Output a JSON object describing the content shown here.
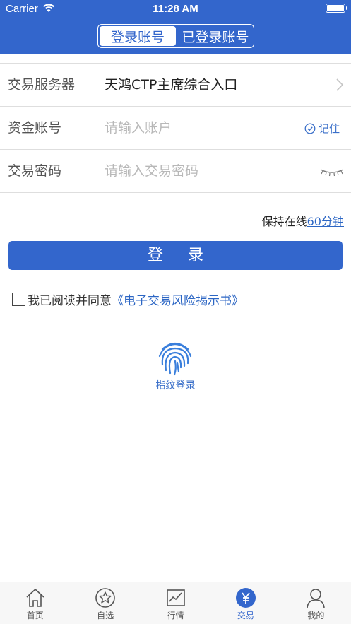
{
  "status": {
    "carrier": "Carrier",
    "time": "11:28 AM"
  },
  "segment": {
    "tabs": [
      {
        "label": "登录账号",
        "active": true
      },
      {
        "label": "已登录账号",
        "active": false
      }
    ]
  },
  "form": {
    "server": {
      "label": "交易服务器",
      "value": "天鸿CTP主席综合入口"
    },
    "account": {
      "label": "资金账号",
      "placeholder": "请输入账户",
      "remember_label": "记住"
    },
    "password": {
      "label": "交易密码",
      "placeholder": "请输入交易密码"
    }
  },
  "keep_online": {
    "prefix": "保持在线",
    "duration": "60分钟"
  },
  "login_button": "登 录",
  "agreement": {
    "text": "我已阅读并同意",
    "link": "《电子交易风险揭示书》",
    "checked": false
  },
  "fingerprint_label": "指纹登录",
  "tabbar": {
    "items": [
      {
        "label": "首页",
        "icon": "home-icon"
      },
      {
        "label": "自选",
        "icon": "star-icon"
      },
      {
        "label": "行情",
        "icon": "chart-icon"
      },
      {
        "label": "交易",
        "icon": "yen-icon",
        "active": true
      },
      {
        "label": "我的",
        "icon": "user-icon"
      }
    ]
  },
  "colors": {
    "primary": "#3366cc",
    "link": "#2c66c4",
    "divider": "#dedede",
    "placeholder": "#b8b8b8"
  }
}
